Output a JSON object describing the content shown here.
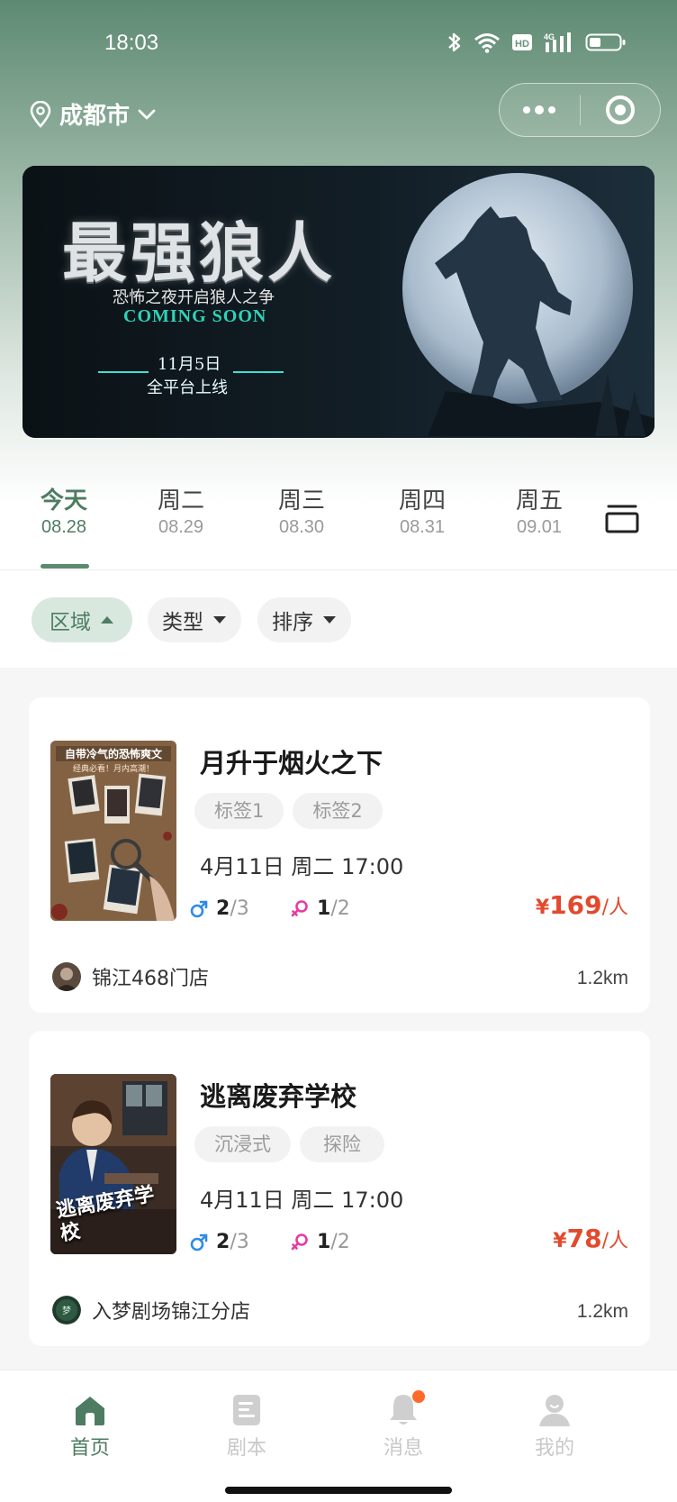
{
  "status": {
    "time": "18:03"
  },
  "header": {
    "city": "成都市"
  },
  "banner": {
    "title": "最强狼人",
    "subtitle": "恐怖之夜开启狼人之争",
    "coming_soon": "COMING SOON",
    "release_date": "11月5日",
    "release_note": "全平台上线"
  },
  "date_tabs": [
    {
      "day": "今天",
      "date": "08.28"
    },
    {
      "day": "周二",
      "date": "08.29"
    },
    {
      "day": "周三",
      "date": "08.30"
    },
    {
      "day": "周四",
      "date": "08.31"
    },
    {
      "day": "周五",
      "date": "09.01"
    }
  ],
  "filters": [
    {
      "label": "区域"
    },
    {
      "label": "类型"
    },
    {
      "label": "排序"
    }
  ],
  "cards": [
    {
      "title": "月升于烟火之下",
      "tags": [
        "标签1",
        "标签2"
      ],
      "time": "4月11日 周二  17:00",
      "male": {
        "current": "2",
        "total": "3"
      },
      "female": {
        "current": "1",
        "total": "2"
      },
      "price": {
        "symbol": "¥",
        "amount": "169",
        "unit": "/人"
      },
      "store": "锦江468门店",
      "distance": "1.2km",
      "poster_text": {
        "headline": "自带冷气的恐怖爽文",
        "sub": "经典必看！月内高潮！"
      }
    },
    {
      "title": "逃离废弃学校",
      "tags": [
        "沉浸式",
        "探险"
      ],
      "time": "4月11日 周二  17:00",
      "male": {
        "current": "2",
        "total": "3"
      },
      "female": {
        "current": "1",
        "total": "2"
      },
      "price": {
        "symbol": "¥",
        "amount": "78",
        "unit": "/人"
      },
      "store": "入梦剧场锦江分店",
      "distance": "1.2km",
      "poster_text": {
        "headline": "逃离废弃学校"
      }
    }
  ],
  "tabbar": [
    {
      "label": "首页",
      "icon": "home-icon"
    },
    {
      "label": "剧本",
      "icon": "script-icon"
    },
    {
      "label": "消息",
      "icon": "bell-icon"
    },
    {
      "label": "我的",
      "icon": "user-icon"
    }
  ],
  "colors": {
    "accent": "#4e7c62",
    "price": "#e24a2e",
    "male": "#2f8be6",
    "female": "#e83aa0",
    "badge": "#ff6a2a"
  }
}
